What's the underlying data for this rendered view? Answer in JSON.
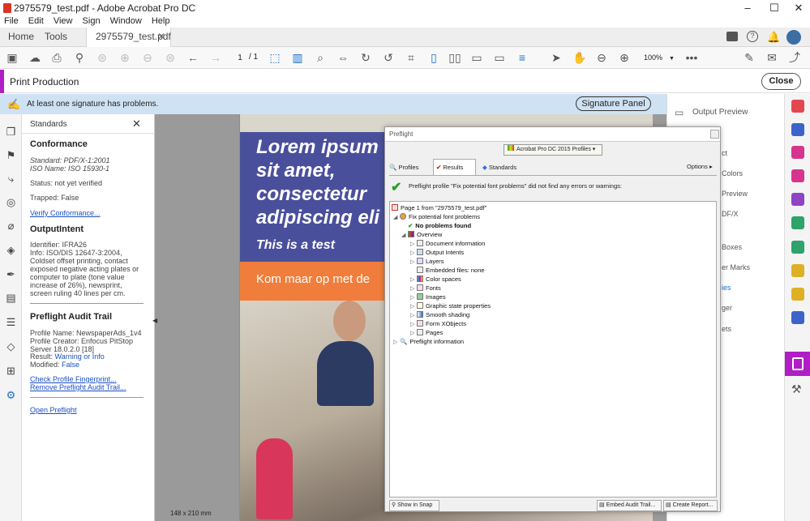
{
  "window": {
    "title": "2975579_test.pdf - Adobe Acrobat Pro DC"
  },
  "menu": [
    "File",
    "Edit",
    "View",
    "Sign",
    "Window",
    "Help"
  ],
  "tabs": {
    "home": "Home",
    "tools": "Tools",
    "doc": "2975579_test.pdf"
  },
  "toolbar": {
    "page_current": "1",
    "page_total": "/  1",
    "zoom": "100%"
  },
  "print_production": {
    "title": "Print Production",
    "close": "Close"
  },
  "notice": {
    "text": "At least one signature has problems.",
    "button": "Signature Panel"
  },
  "standards": {
    "title": "Standards",
    "conformance_heading": "Conformance",
    "standard": "Standard: PDF/X-1:2001",
    "iso": "ISO Name: ISO 15930-1",
    "status": "Status: not yet verified",
    "trapped": "Trapped: False",
    "verify": "Verify Conformance...",
    "output_heading": "OutputIntent",
    "identifier": "Identifier: IFRA26",
    "info": "Info: ISO/DIS 12647-3:2004, Coldset offset printing, contact exposed negative acting plates or computer to plate (tone value increase of 26%), newsprint, screen ruling 40 lines per cm.",
    "audit_heading": "Preflight Audit Trail",
    "profile_name": "Profile Name: NewspaperAds_1v4",
    "profile_creator": "Profile Creator: Enfocus PitStop Server 18.0.2.0 [18]",
    "result_label": "Result:",
    "result_value": "Warning or Info",
    "modified_label": "Modified:",
    "modified_value": "False",
    "check": "Check Profile Fingerprint...",
    "remove": "Remove Preflight Audit Trail...",
    "open": "Open Preflight"
  },
  "page": {
    "line1": "Lorem ipsum",
    "line2": "sit amet,",
    "line3": "consectetur",
    "line4": "adipiscing eli",
    "subtitle": "This is a test",
    "orange": "Kom maar op met de",
    "size": "148 x 210 mm"
  },
  "right_panel": {
    "items": [
      "Output Preview",
      "ct",
      "Colors",
      "Preview",
      "DF/X",
      "Boxes",
      "er Marks",
      "ies",
      "ger",
      "ets"
    ]
  },
  "preflight": {
    "title": "Preflight",
    "profile_select": "Acrobat Pro DC 2015 Profiles",
    "tabs": [
      "Profiles",
      "Results",
      "Standards"
    ],
    "options": "Options",
    "message": "Preflight profile \"Fix potential font problems\" did not find any errors or warnings:",
    "tree": [
      {
        "label": "Page 1 from \"2975579_test.pdf\"",
        "level": 0,
        "bold": false,
        "arrow": ""
      },
      {
        "label": "Fix potential font problems",
        "level": 1,
        "bold": false,
        "arrow": "◢"
      },
      {
        "label": "No problems found",
        "level": 2,
        "bold": true,
        "arrow": ""
      },
      {
        "label": "Overview",
        "level": 2,
        "bold": false,
        "arrow": "◢"
      },
      {
        "label": "Document information",
        "level": 3,
        "bold": false,
        "arrow": "▷"
      },
      {
        "label": "Output Intents",
        "level": 3,
        "bold": false,
        "arrow": "▷"
      },
      {
        "label": "Layers",
        "level": 3,
        "bold": false,
        "arrow": "▷"
      },
      {
        "label": "Embedded files: none",
        "level": 3,
        "bold": false,
        "arrow": ""
      },
      {
        "label": "Color spaces",
        "level": 3,
        "bold": false,
        "arrow": "▷"
      },
      {
        "label": "Fonts",
        "level": 3,
        "bold": false,
        "arrow": "▷"
      },
      {
        "label": "Images",
        "level": 3,
        "bold": false,
        "arrow": "▷"
      },
      {
        "label": "Graphic state properties",
        "level": 3,
        "bold": false,
        "arrow": "▷"
      },
      {
        "label": "Smooth shading",
        "level": 3,
        "bold": false,
        "arrow": "▷"
      },
      {
        "label": "Form XObjects",
        "level": 3,
        "bold": false,
        "arrow": "▷"
      },
      {
        "label": "Pages",
        "level": 3,
        "bold": false,
        "arrow": "▷"
      },
      {
        "label": "Preflight information",
        "level": 0,
        "bold": false,
        "arrow": "▷"
      }
    ],
    "show_snap": "Show in Snap",
    "embed": "Embed Audit Trail...",
    "create": "Create Report..."
  },
  "colors": {
    "accent": "#b01ec6",
    "link": "#1a4fc4",
    "banner": "#4a4f9c",
    "orange": "#f07d3b",
    "check": "#2aa02a"
  }
}
